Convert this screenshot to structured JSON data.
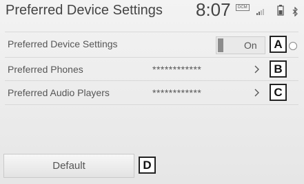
{
  "header": {
    "title": "Preferred Device Settings",
    "clock": "8:07",
    "dcm_badge": "DCM",
    "icons": [
      "signal-icon",
      "battery-icon",
      "bluetooth-icon"
    ]
  },
  "rows": [
    {
      "label": "Preferred Device Settings",
      "toggle_label": "On",
      "badge": "A"
    },
    {
      "label": "Preferred Phones",
      "value": "************",
      "badge": "B"
    },
    {
      "label": "Preferred Audio Players",
      "value": "************",
      "badge": "C"
    }
  ],
  "footer": {
    "default_label": "Default",
    "badge": "D"
  },
  "colors": {
    "background": "#ececec",
    "text": "#555555",
    "badge_border": "#222222"
  }
}
